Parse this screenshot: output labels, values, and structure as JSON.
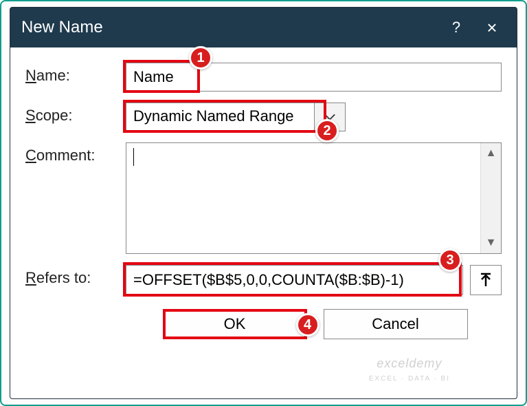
{
  "titlebar": {
    "title": "New Name",
    "help": "?",
    "close": "×"
  },
  "labels": {
    "name": "Name:",
    "scope": "Scope:",
    "comment": "Comment:",
    "refers_to": "Refers to:"
  },
  "fields": {
    "name_value": "Name",
    "scope_selected": "Dynamic Named Range",
    "comment_value": "",
    "refers_to_value": "=OFFSET($B$5,0,0,COUNTA($B:$B)-1)"
  },
  "buttons": {
    "ok": "OK",
    "cancel": "Cancel"
  },
  "annotations": {
    "b1": "1",
    "b2": "2",
    "b3": "3",
    "b4": "4"
  },
  "watermark": {
    "main": "exceldemy",
    "sub": "EXCEL · DATA · BI"
  }
}
